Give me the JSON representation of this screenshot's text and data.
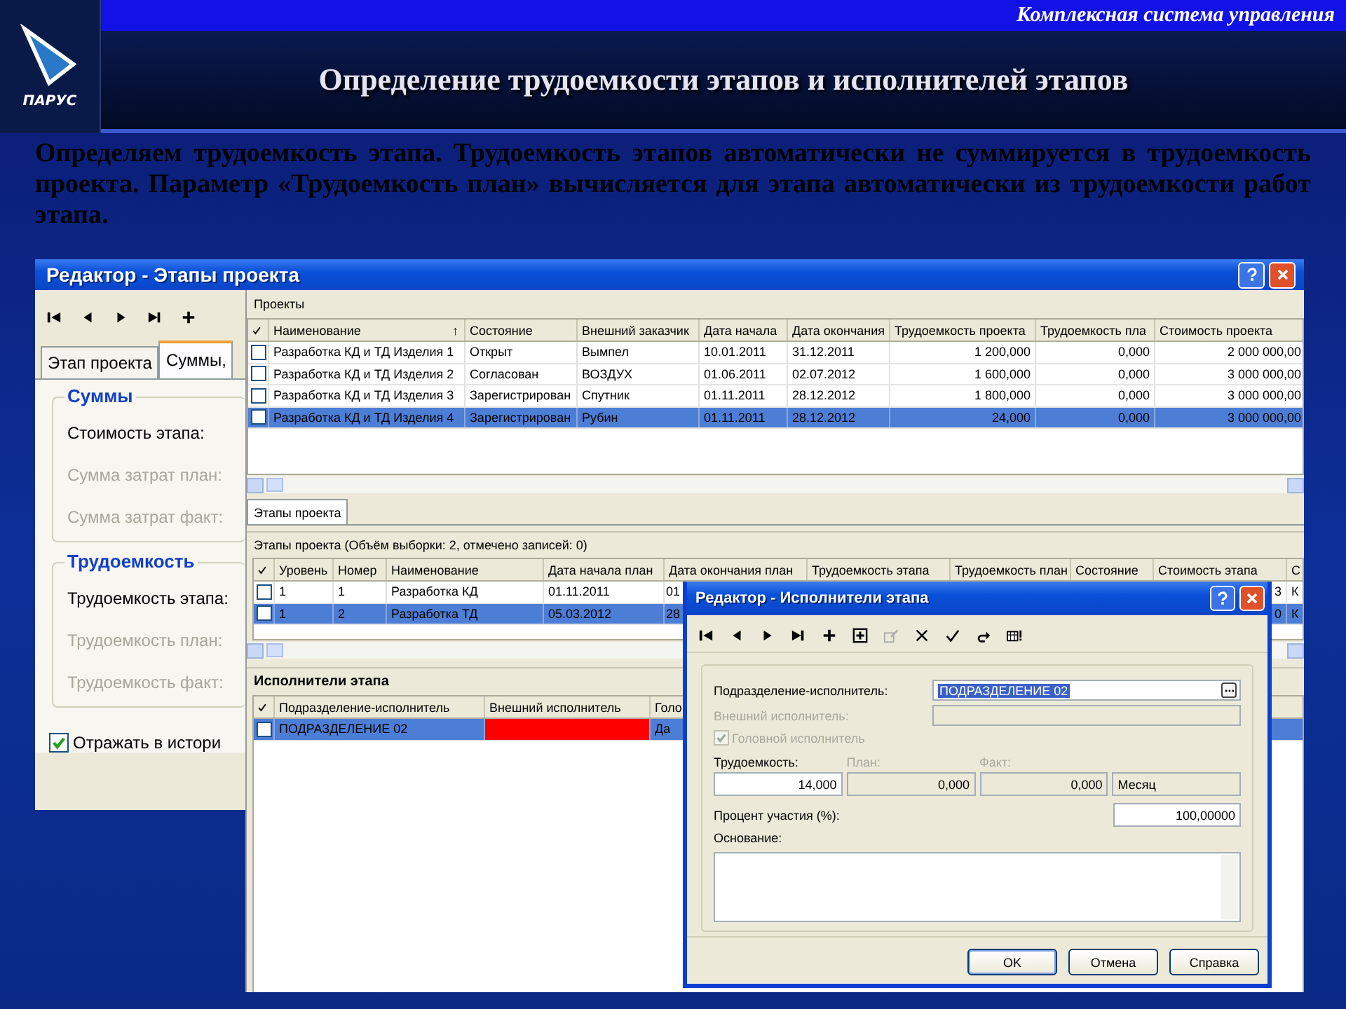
{
  "header": {
    "logo_text": "ПАРУС",
    "tagline": "Комплексная система управления",
    "title": "Определение трудоемкости этапов и исполнителей этапов"
  },
  "intro": "Определяем трудоемкость этапа. Трудоемкость этапов автоматически не суммируется в трудоемкость проекта. Параметр «Трудоемкость план» вычисляется для этапа автоматически из трудоемкости работ этапа.",
  "stage_editor": {
    "title": "Редактор - Этапы проекта",
    "tabs": [
      {
        "label": "Этап проекта",
        "selected": false
      },
      {
        "label": "Суммы,",
        "selected": true
      }
    ],
    "groups": [
      {
        "title": "Суммы",
        "fields": [
          {
            "label": "Стоимость этапа:",
            "disabled": false
          },
          {
            "label": "Сумма затрат план:",
            "disabled": true
          },
          {
            "label": "Сумма затрат факт:",
            "disabled": true
          }
        ]
      },
      {
        "title": "Трудоемкость",
        "fields": [
          {
            "label": "Трудоемкость этапа:",
            "disabled": false
          },
          {
            "label": "Трудоемкость план:",
            "disabled": true
          },
          {
            "label": "Трудоемкость факт:",
            "disabled": true
          }
        ]
      }
    ],
    "history": {
      "label": "Отражать в истори",
      "checked": true
    }
  },
  "projects": {
    "title": "Проекты",
    "columns": [
      {
        "label": "Наименование",
        "sort_mark": "↑"
      },
      {
        "label": "Состояние"
      },
      {
        "label": "Внешний заказчик"
      },
      {
        "label": "Дата начала"
      },
      {
        "label": "Дата окончания"
      },
      {
        "label": "Трудоемкость проекта"
      },
      {
        "label": "Трудоемкость пла"
      },
      {
        "label": "Стоимость проекта"
      }
    ],
    "rows": [
      {
        "selected": false,
        "checked": false,
        "cells": [
          "Разработка КД и ТД Изделия 1",
          "Открыт",
          "Вымпел",
          "10.01.2011",
          "31.12.2011",
          "1 200,000",
          "0,000",
          "2 000 000,00"
        ]
      },
      {
        "selected": false,
        "checked": false,
        "cells": [
          "Разработка КД и ТД Изделия 2",
          "Согласован",
          "ВОЗДУХ",
          "01.06.2011",
          "02.07.2012",
          "1 600,000",
          "0,000",
          "3 000 000,00"
        ]
      },
      {
        "selected": false,
        "checked": false,
        "cells": [
          "Разработка КД и ТД Изделия 3",
          "Зарегистрирован",
          "Спутник",
          "01.11.2011",
          "28.12.2012",
          "1 800,000",
          "0,000",
          "3 000 000,00"
        ]
      },
      {
        "selected": true,
        "checked": false,
        "cells": [
          "Разработка КД и ТД Изделия 4",
          "Зарегистрирован",
          "Рубин",
          "01.11.2011",
          "28.12.2012",
          "24,000",
          "0,000",
          "3 000 000,00"
        ]
      }
    ]
  },
  "stages": {
    "tab": {
      "label": "Этапы проекта",
      "selected": true
    },
    "summary": "Этапы проекта (Объём выборки: 2, отмечено записей: 0)",
    "columns": [
      {
        "label": "Уровень"
      },
      {
        "label": "Номер"
      },
      {
        "label": "Наименование"
      },
      {
        "label": "Дата начала план"
      },
      {
        "label": "Дата окончания план"
      },
      {
        "label": "Трудоемкость этапа"
      },
      {
        "label": "Трудоемкость план"
      },
      {
        "label": "Состояние"
      },
      {
        "label": "Стоимость этапа"
      },
      {
        "label": "С"
      }
    ],
    "rows": [
      {
        "selected": false,
        "checked": false,
        "cells": [
          "1",
          "1",
          "Разработка КД",
          "01.11.2011",
          "01",
          null,
          null,
          null,
          "3",
          "К"
        ]
      },
      {
        "selected": true,
        "checked": false,
        "cells": [
          "1",
          "2",
          "Разработка ТД",
          "05.03.2012",
          "28",
          null,
          null,
          null,
          "0",
          "К"
        ]
      }
    ]
  },
  "performers": {
    "title": "Исполнители этапа",
    "columns": [
      {
        "label": "Подразделение-исполнитель"
      },
      {
        "label": "Внешний исполнитель"
      },
      {
        "label": "Голо"
      }
    ],
    "rows": [
      {
        "selected": true,
        "checked": false,
        "department": "ПОДРАЗДЕЛЕНИЕ 02",
        "color": "#ff0000",
        "head": "Да"
      }
    ]
  },
  "performer_editor": {
    "title": "Редактор - Исполнители этапа",
    "department": {
      "label": "Подразделение-исполнитель:",
      "value": "ПОДРАЗДЕЛЕНИЕ 02"
    },
    "external": {
      "label": "Внешний исполнитель:",
      "disabled": true
    },
    "head": {
      "label": "Головной исполнитель",
      "checked": true,
      "disabled": true
    },
    "labor": {
      "label": "Трудоемкость:",
      "value": "14,000",
      "disabled": false
    },
    "plan": {
      "label": "План:",
      "value": "0,000",
      "disabled": true
    },
    "fact": {
      "label": "Факт:",
      "value": "0,000",
      "disabled": true
    },
    "unit": {
      "value": "Месяц"
    },
    "share": {
      "label": "Процент участия (%):",
      "value": "100,00000"
    },
    "basis": {
      "label": "Основание:"
    },
    "buttons": [
      {
        "label": "OK",
        "default": true
      },
      {
        "label": "Отмена",
        "default": false
      },
      {
        "label": "Справка",
        "default": false
      }
    ]
  }
}
